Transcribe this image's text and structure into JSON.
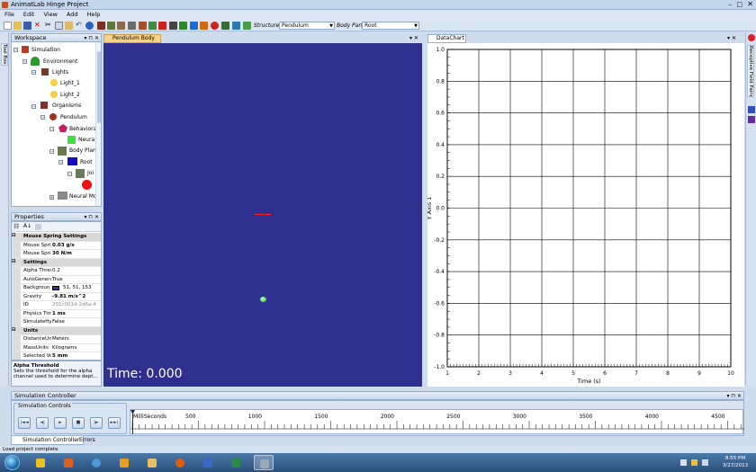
{
  "window": {
    "title": "AnimatLab Hinge Project"
  },
  "menu": [
    "File",
    "Edit",
    "View",
    "Add",
    "Help"
  ],
  "toolbar": {
    "structure_label": "Structure:",
    "structure_value": "Pendulum",
    "body_part_label": "Body Part:",
    "body_part_value": "Root"
  },
  "left_strip": {
    "tab": "Tool Box"
  },
  "right_strip": {
    "tab": "Receptive Field Pairs"
  },
  "workspace": {
    "title": "Workspace",
    "tree": [
      {
        "label": "Simulation",
        "icon": "simulation-icon"
      },
      {
        "label": "Environment",
        "icon": "tree-icon"
      },
      {
        "label": "Lights",
        "icon": "lights-icon"
      },
      {
        "label": "Light_1",
        "icon": "bulb-icon"
      },
      {
        "label": "Light_2",
        "icon": "bulb-icon"
      },
      {
        "label": "Organisms",
        "icon": "organisms-icon"
      },
      {
        "label": "Pendulum",
        "icon": "organism-icon"
      },
      {
        "label": "Behaviora",
        "icon": "neuron-icon"
      },
      {
        "label": "Neura",
        "icon": "green-square-icon"
      },
      {
        "label": "Body Plan",
        "icon": "body-plan-icon"
      },
      {
        "label": "Root",
        "icon": "blue-box-icon"
      },
      {
        "label": "Joi",
        "icon": "joint-icon"
      },
      {
        "label": "",
        "icon": "red-sphere-icon"
      },
      {
        "label": "Neural Mo",
        "icon": "neural-module-icon"
      }
    ]
  },
  "properties": {
    "title": "Properties",
    "rows": [
      {
        "type": "category",
        "key": "Mouse Spring Settings",
        "value": ""
      },
      {
        "type": "row",
        "key": "Mouse Spri",
        "value": "0.03 g/s",
        "bold": true
      },
      {
        "type": "row",
        "key": "Mouse Spri",
        "value": "30 N/m",
        "bold": true
      },
      {
        "type": "category",
        "key": "Settings",
        "value": ""
      },
      {
        "type": "row",
        "key": "Alpha Thres",
        "value": "0.2"
      },
      {
        "type": "row",
        "key": "AutoGenera",
        "value": "True"
      },
      {
        "type": "row",
        "key": "Backgroun",
        "value": "51, 51, 153",
        "swatch": "#333399"
      },
      {
        "type": "row",
        "key": "Gravity",
        "value": "-9.81 m/s^2",
        "bold": true
      },
      {
        "type": "row",
        "key": "ID",
        "value": "201c001d-2d6a-4",
        "grey": true
      },
      {
        "type": "row",
        "key": "Physics Tim",
        "value": "1 ms",
        "bold": true
      },
      {
        "type": "row",
        "key": "SimulateHy",
        "value": "False"
      },
      {
        "type": "category",
        "key": "Units",
        "value": ""
      },
      {
        "type": "row",
        "key": "DistanceUn",
        "value": "Meters"
      },
      {
        "type": "row",
        "key": "MassUnits",
        "value": "Kilograms"
      },
      {
        "type": "row",
        "key": "Selected Vo",
        "value": "5 mm",
        "bold": true
      }
    ],
    "help_title": "Alpha Threshold",
    "help_text": "Sets the threshold for the alpha channel used to determine dept..."
  },
  "viewport": {
    "tab": "Pendulum Body",
    "time_text": "Time: 0.000",
    "background": "#2e2f8e"
  },
  "chart_panel": {
    "tab": "DataChart"
  },
  "chart_data": {
    "type": "line",
    "title": "",
    "xlabel": "Time (s)",
    "ylabel": "Y Axis 1",
    "xlim": [
      1,
      10
    ],
    "ylim": [
      -1.0,
      1.0
    ],
    "x_ticks": [
      1,
      2,
      3,
      4,
      5,
      6,
      7,
      8,
      9,
      10
    ],
    "y_ticks": [
      "1.0",
      "0.8",
      "0.6",
      "0.4",
      "0.2",
      "0.0",
      "-0.2",
      "-0.4",
      "-0.6",
      "-0.8",
      "-1.0"
    ],
    "grid": true,
    "series": []
  },
  "sim_controller": {
    "title": "Simulation Controller",
    "controls_label": "Simulation Controls",
    "buttons": [
      "|◄◄",
      "◄|",
      "►",
      "■",
      "|►",
      "►►|"
    ],
    "timeline_unit": "MilliSeconds",
    "timeline_labels": [
      "500",
      "1000",
      "1500",
      "2000",
      "2500",
      "3000",
      "3500",
      "4000",
      "4500"
    ]
  },
  "bottom_tabs": [
    "Simulation Controller",
    "Errors"
  ],
  "status": "Load project complete",
  "taskbar": {
    "clock_time": "8:55 PM",
    "clock_date": "3/27/2013",
    "apps": [
      "animatlab-icon",
      "figure-icon",
      "chrome-icon",
      "outlook-icon",
      "folder-icon",
      "firefox-icon",
      "link-icon",
      "terminal-icon",
      "tools-icon"
    ]
  }
}
